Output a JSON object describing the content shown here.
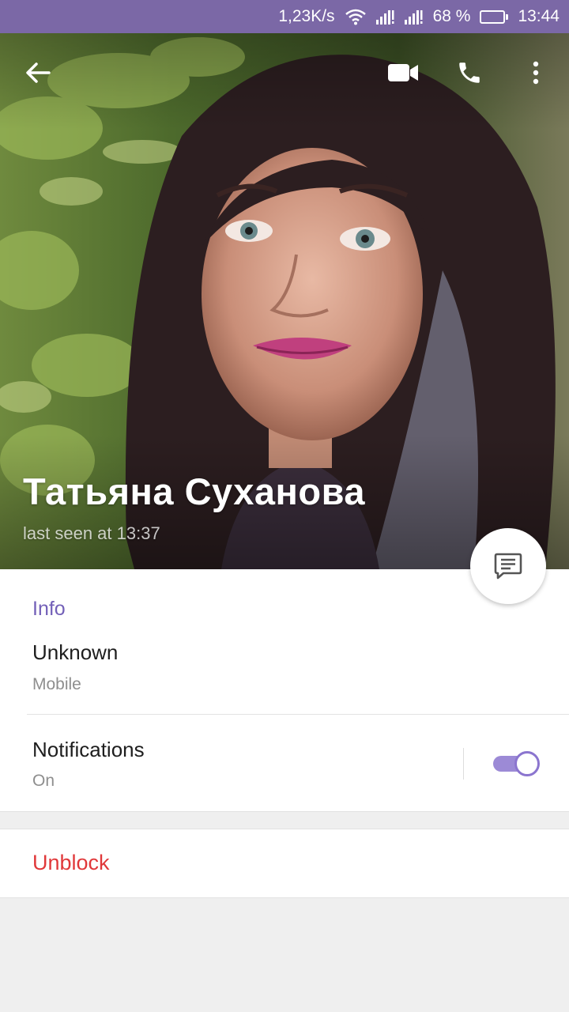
{
  "status_bar": {
    "speed": "1,23K/s",
    "battery": "68 %",
    "battery_level": 0.68,
    "time": "13:44"
  },
  "toolbar": {
    "back_icon": "arrow-left-icon",
    "video_icon": "video-camera-icon",
    "call_icon": "phone-icon",
    "menu_icon": "more-vert-icon"
  },
  "contact": {
    "name": "Татьяна Суханова",
    "last_seen": "last seen at 13:37"
  },
  "fab": {
    "icon": "message-icon"
  },
  "info": {
    "section_title": "Info",
    "phone_title": "Unknown",
    "phone_type": "Mobile",
    "notifications_title": "Notifications",
    "notifications_state": "On",
    "notifications_enabled": true
  },
  "actions": {
    "unblock_label": "Unblock"
  },
  "colors": {
    "accent": "#7360b8",
    "status_bar": "#7b68a6",
    "danger": "#e0383a"
  }
}
